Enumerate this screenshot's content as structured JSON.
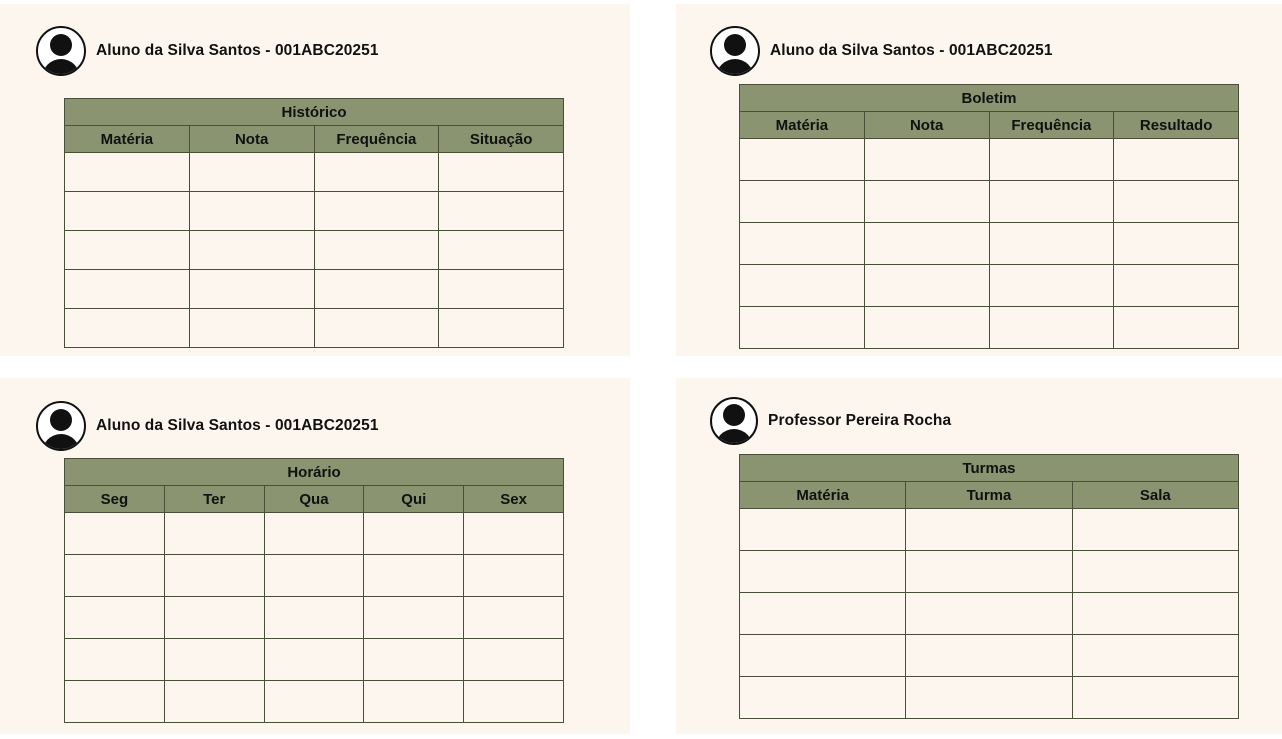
{
  "panels": [
    {
      "user": "Aluno da Silva Santos - 001ABC20251",
      "table_title": "Histórico",
      "columns": [
        "Matéria",
        "Nota",
        "Frequência",
        "Situação"
      ],
      "row_count": 5
    },
    {
      "user": "Aluno da Silva Santos - 001ABC20251",
      "table_title": "Boletim",
      "columns": [
        "Matéria",
        "Nota",
        "Frequência",
        "Resultado"
      ],
      "row_count": 5
    },
    {
      "user": "Aluno da Silva Santos - 001ABC20251",
      "table_title": "Horário",
      "columns": [
        "Seg",
        "Ter",
        "Qua",
        "Qui",
        "Sex"
      ],
      "row_count": 5
    },
    {
      "user": "Professor Pereira Rocha",
      "table_title": "Turmas",
      "columns": [
        "Matéria",
        "Turma",
        "Sala"
      ],
      "row_count": 5
    }
  ],
  "icons": {
    "avatar": "user-avatar-icon"
  },
  "colors": {
    "panel_bg": "#fdf6ee",
    "header_bg": "#8a9470",
    "border": "#4a4f3a"
  }
}
